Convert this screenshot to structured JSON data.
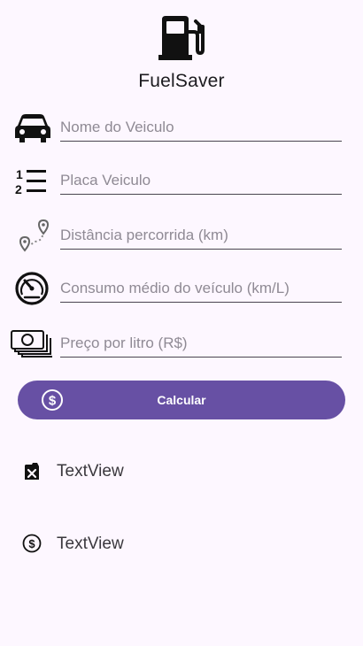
{
  "app": {
    "title": "FuelSaver",
    "logo_icon": "gas-pump-icon",
    "accent_color": "#6750a4"
  },
  "form": {
    "fields": [
      {
        "id": "vehicle-name",
        "icon": "car-icon",
        "placeholder": "Nome do Veiculo",
        "value": ""
      },
      {
        "id": "vehicle-plate",
        "icon": "numbered-list-icon",
        "placeholder": "Placa Veiculo",
        "value": ""
      },
      {
        "id": "distance",
        "icon": "route-pin-icon",
        "placeholder": "Distância percorrida (km)",
        "value": ""
      },
      {
        "id": "consumption",
        "icon": "speedometer-icon",
        "placeholder": "Consumo médio do veículo (km/L)",
        "value": ""
      },
      {
        "id": "price",
        "icon": "money-stack-icon",
        "placeholder": "Preço por litro (R$)",
        "value": ""
      }
    ],
    "calculate_button": {
      "label": "Calcular",
      "icon": "dollar-circle-icon"
    }
  },
  "results": [
    {
      "icon": "no-fuel-icon",
      "text": "TextView"
    },
    {
      "icon": "dollar-circle-icon",
      "text": "TextView"
    }
  ]
}
